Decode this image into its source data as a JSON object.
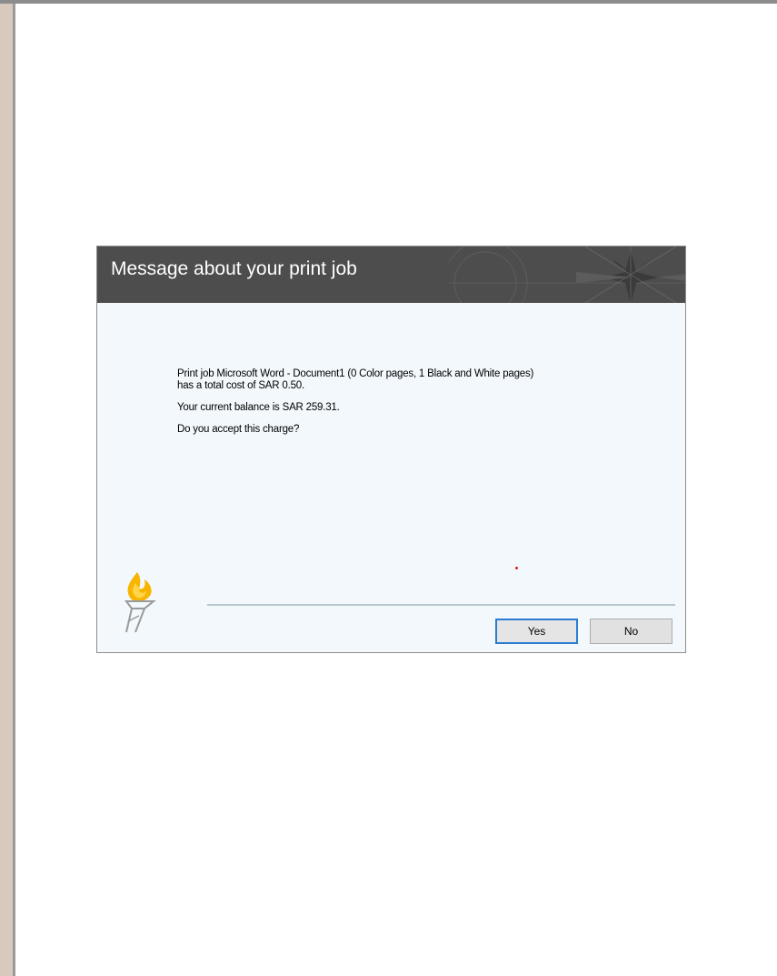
{
  "dialog": {
    "title": "Message about your print job",
    "message": {
      "line1": "Print job Microsoft Word - Document1 (0 Color pages, 1 Black and White pages)",
      "line2": "has a total cost of SAR 0.50.",
      "balance": "Your current balance is SAR 259.31.",
      "question": "Do you accept this charge?"
    },
    "buttons": {
      "yes_label": "Yes",
      "no_label": "No"
    }
  },
  "colors": {
    "header_bg": "#4d4d4d",
    "dialog_bg": "#f3f8fc",
    "default_button_border": "#2b7bd1",
    "logo_flame": "#f7b500"
  },
  "icons": {
    "logo": "torch-logo-icon",
    "header_decoration": "compass-rose-icon"
  }
}
